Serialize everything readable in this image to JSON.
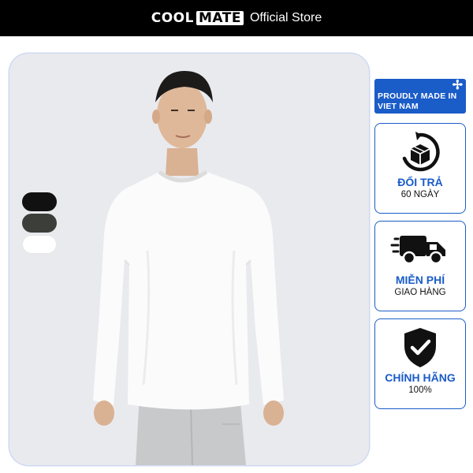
{
  "header": {
    "brand_part1": "COOL",
    "brand_part2": "MATE",
    "tagline": "Official Store"
  },
  "product": {
    "color_swatches": [
      "black",
      "olive",
      "white"
    ]
  },
  "made_in": {
    "text": "PROUDLY MADE IN VIET NAM",
    "icon": "plus-star-icon"
  },
  "badges": [
    {
      "icon": "return-box-icon",
      "title": "ĐỔI TRẢ",
      "subtitle": "60 NGÀY"
    },
    {
      "icon": "delivery-truck-icon",
      "title": "MIỄN PHÍ",
      "subtitle": "GIAO HÀNG"
    },
    {
      "icon": "shield-check-icon",
      "title": "CHÍNH HÃNG",
      "subtitle": "100%"
    }
  ],
  "colors": {
    "accent": "#1a5cc8",
    "header_bg": "#000000",
    "photo_bg": "#e9eaee"
  }
}
